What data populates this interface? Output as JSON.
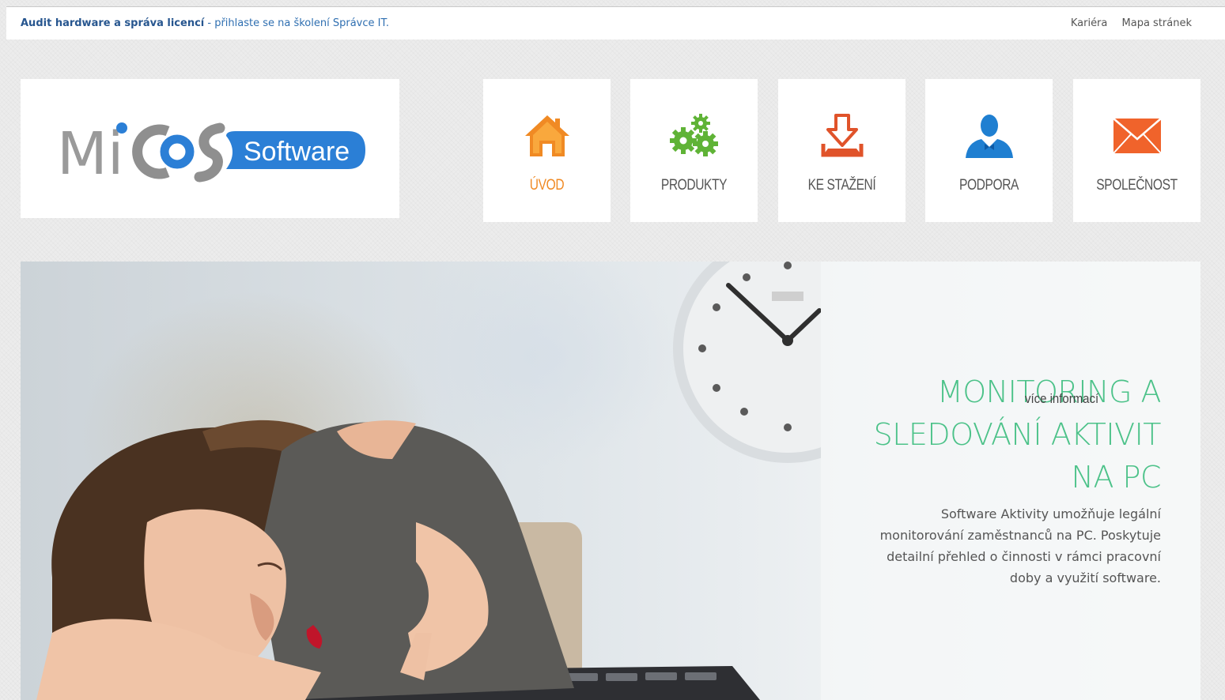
{
  "topbar": {
    "promo_strong": "Audit hardware a správa licencí",
    "promo_rest": " - přihlaste se na školení Správce IT.",
    "links": [
      "Kariéra",
      "Mapa stránek"
    ]
  },
  "logo": {
    "text_mi": "Mi",
    "text_software": "Software"
  },
  "nav": [
    {
      "label": "ÚVOD",
      "icon": "home-icon",
      "active": true
    },
    {
      "label": "PRODUKTY",
      "icon": "gears-icon",
      "active": false
    },
    {
      "label": "KE STAŽENÍ",
      "icon": "download-icon",
      "active": false
    },
    {
      "label": "PODPORA",
      "icon": "support-person-icon",
      "active": false
    },
    {
      "label": "SPOLEČNOST",
      "icon": "envelope-icon",
      "active": false
    }
  ],
  "hero": {
    "title_lines": [
      "MONITORING A",
      "SLEDOVÁNÍ AKTIVIT",
      "NA PC"
    ],
    "text": "Software Aktivity umožňuje legální monitorování zaměstnanců na PC. Poskytuje detailní přehled o činnosti v rámci pracovní doby a využití software.",
    "more_link": "více informací"
  },
  "colors": {
    "accent_orange": "#f08a24",
    "accent_green": "#5fb336",
    "accent_red": "#e0532a",
    "accent_blue": "#1f7fd1",
    "title_green": "#4cc289",
    "brand_blue": "#2b7fd6"
  }
}
